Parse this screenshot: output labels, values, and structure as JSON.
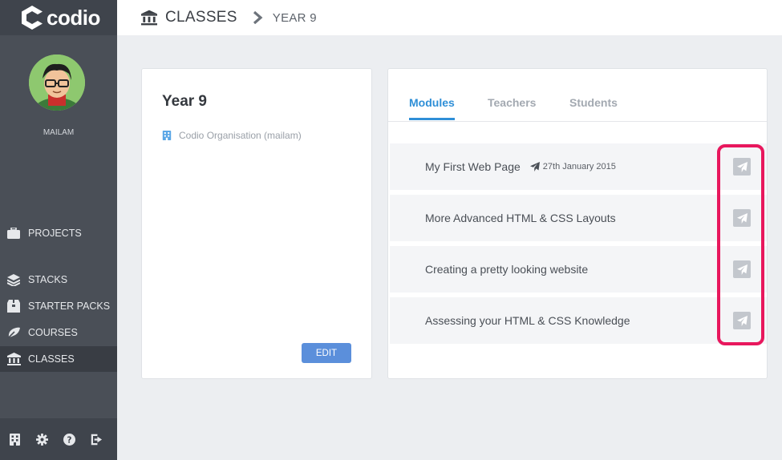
{
  "brand": {
    "logo_text": "codio"
  },
  "header": {
    "crumb1": "CLASSES",
    "crumb2": "YEAR 9"
  },
  "sidebar": {
    "username": "MAILAM",
    "items": [
      {
        "label": "PROJECTS",
        "icon": "briefcase-icon"
      },
      {
        "label": "STACKS",
        "icon": "layers-icon"
      },
      {
        "label": "STARTER PACKS",
        "icon": "box-icon"
      },
      {
        "label": "COURSES",
        "icon": "courses-icon"
      },
      {
        "label": "CLASSES",
        "icon": "institution-icon",
        "active": true
      }
    ],
    "footer_icons": [
      "building-icon",
      "gear-icon",
      "help-icon",
      "logout-icon"
    ]
  },
  "class_card": {
    "title": "Year 9",
    "organisation": "Codio Organisation (mailam)",
    "edit_label": "EDIT"
  },
  "tabs": [
    {
      "label": "Modules",
      "active": true
    },
    {
      "label": "Teachers",
      "active": false
    },
    {
      "label": "Students",
      "active": false
    }
  ],
  "modules": [
    {
      "title": "My First Web Page",
      "published": "27th January 2015"
    },
    {
      "title": "More Advanced HTML & CSS Layouts"
    },
    {
      "title": "Creating a pretty looking website"
    },
    {
      "title": "Assessing your HTML & CSS Knowledge"
    }
  ],
  "colors": {
    "accent": "#2f8fd7",
    "button": "#5b8fdb",
    "highlight": "#e8175d",
    "sidebar": "#4a4f57"
  }
}
